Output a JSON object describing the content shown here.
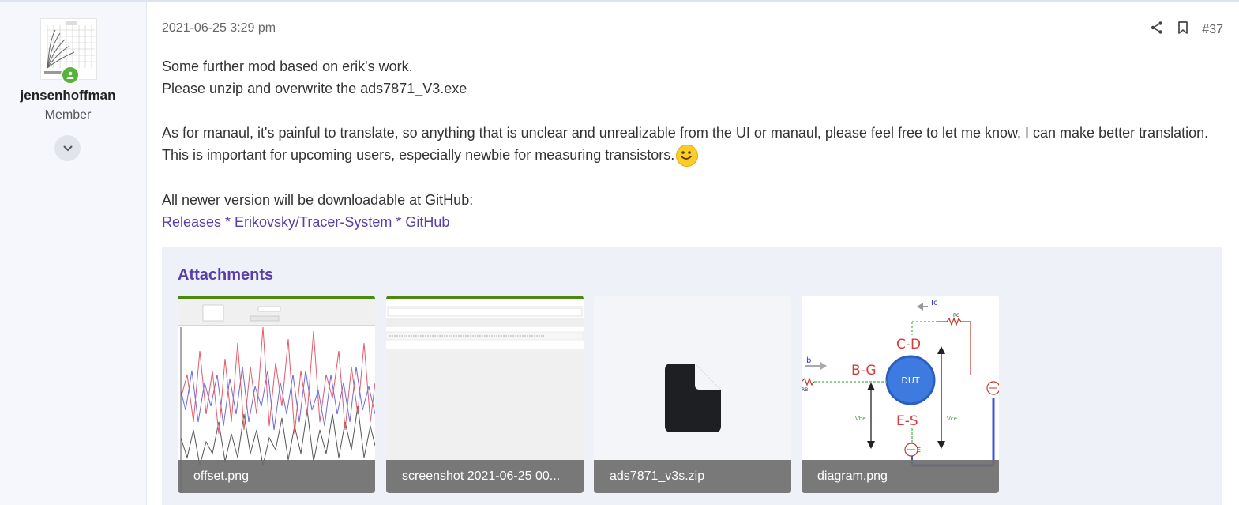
{
  "author": {
    "name": "jensenhoffman",
    "role": "Member"
  },
  "post": {
    "date": "2021-06-25 3:29 pm",
    "number": "#37",
    "line1": "Some further mod based on erik's work.",
    "line2": "Please unzip and overwrite the ads7871_V3.exe",
    "para2": "As for manaul, it's painful to translate, so anything that is unclear and unrealizable from the UI or manaul, please feel free to let me know, I can make better translation. This is important for upcoming users, especially newbie for measuring transistors.",
    "para3": "All newer version will be downloadable at GitHub:",
    "link_text": "Releases * Erikovsky/Tracer-System * GitHub"
  },
  "attachments": {
    "title": "Attachments",
    "items": [
      {
        "label": "offset.png",
        "icon": "image-thumbnail"
      },
      {
        "label": "screenshot 2021-06-25 00...",
        "icon": "image-thumbnail"
      },
      {
        "label": "ads7871_v3s.zip",
        "icon": "file-icon"
      },
      {
        "label": "diagram.png",
        "icon": "image-thumbnail"
      }
    ],
    "diagram_text": {
      "ic": "Ic",
      "rc": "RC",
      "cd": "C-D",
      "ib": "Ib",
      "bg": "B-G",
      "dut": "DUT",
      "rb": "RB",
      "es": "E-S",
      "vbe": "Vbe",
      "vce": "Vce",
      "e": "E"
    }
  },
  "colors": {
    "link": "#5b3ea8",
    "online": "#55b33b",
    "sidebar_bg": "#f5f7fc",
    "attachments_bg": "#eef1f8"
  }
}
